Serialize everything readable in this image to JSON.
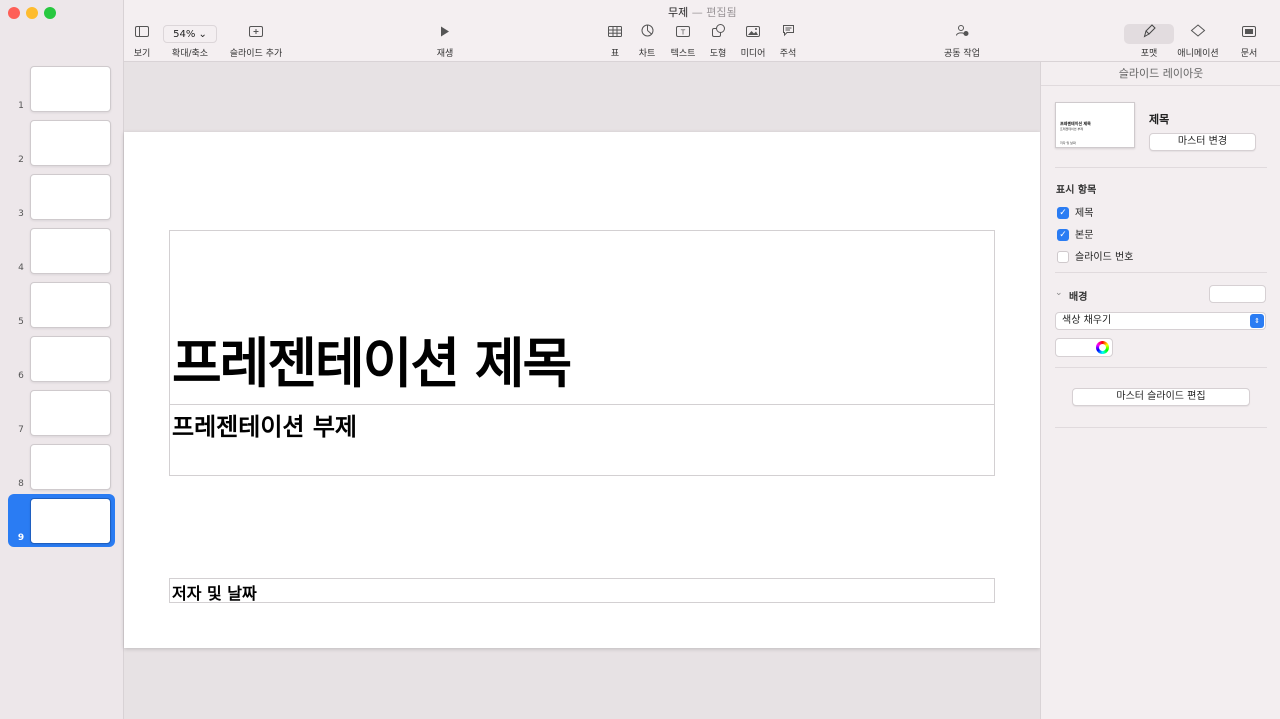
{
  "window": {
    "title": "무제",
    "title_separator": "—",
    "title_status": "편집됨"
  },
  "toolbar": {
    "view_label": "보기",
    "zoom_value": "54%",
    "zoom_label": "확대/축소",
    "add_slide_label": "슬라이드 추가",
    "play_label": "재생",
    "table_label": "표",
    "chart_label": "차트",
    "text_label": "텍스트",
    "shape_label": "도형",
    "media_label": "미디어",
    "comment_label": "주석",
    "collaborate_label": "공동 작업",
    "format_label": "포맷",
    "animate_label": "애니메이션",
    "document_label": "문서"
  },
  "navigator": {
    "slides": [
      {
        "number": "1"
      },
      {
        "number": "2"
      },
      {
        "number": "3"
      },
      {
        "number": "4"
      },
      {
        "number": "5"
      },
      {
        "number": "6"
      },
      {
        "number": "7"
      },
      {
        "number": "8"
      },
      {
        "number": "9"
      }
    ],
    "selected_index": 9,
    "selection_color": "#2a7cf3"
  },
  "slide": {
    "title": "프레젠테이션 제목",
    "subtitle": "프레젠테이션 부제",
    "author_date": "저자 및 날짜"
  },
  "inspector": {
    "header": "슬라이드 레이아웃",
    "master_thumb_title": "프레젠테이션 제목",
    "master_thumb_subtitle": "프레젠테이션 부제",
    "master_thumb_author": "저자 및 날짜",
    "master_name": "제목",
    "change_master_label": "마스터 변경",
    "appearance_title": "표시 항목",
    "appearance_items": [
      {
        "label": "제목",
        "checked": true
      },
      {
        "label": "본문",
        "checked": true
      },
      {
        "label": "슬라이드 번호",
        "checked": false
      }
    ],
    "background_title": "배경",
    "fill_type": "색상 채우기",
    "edit_master_label": "마스터 슬라이드 편집"
  }
}
